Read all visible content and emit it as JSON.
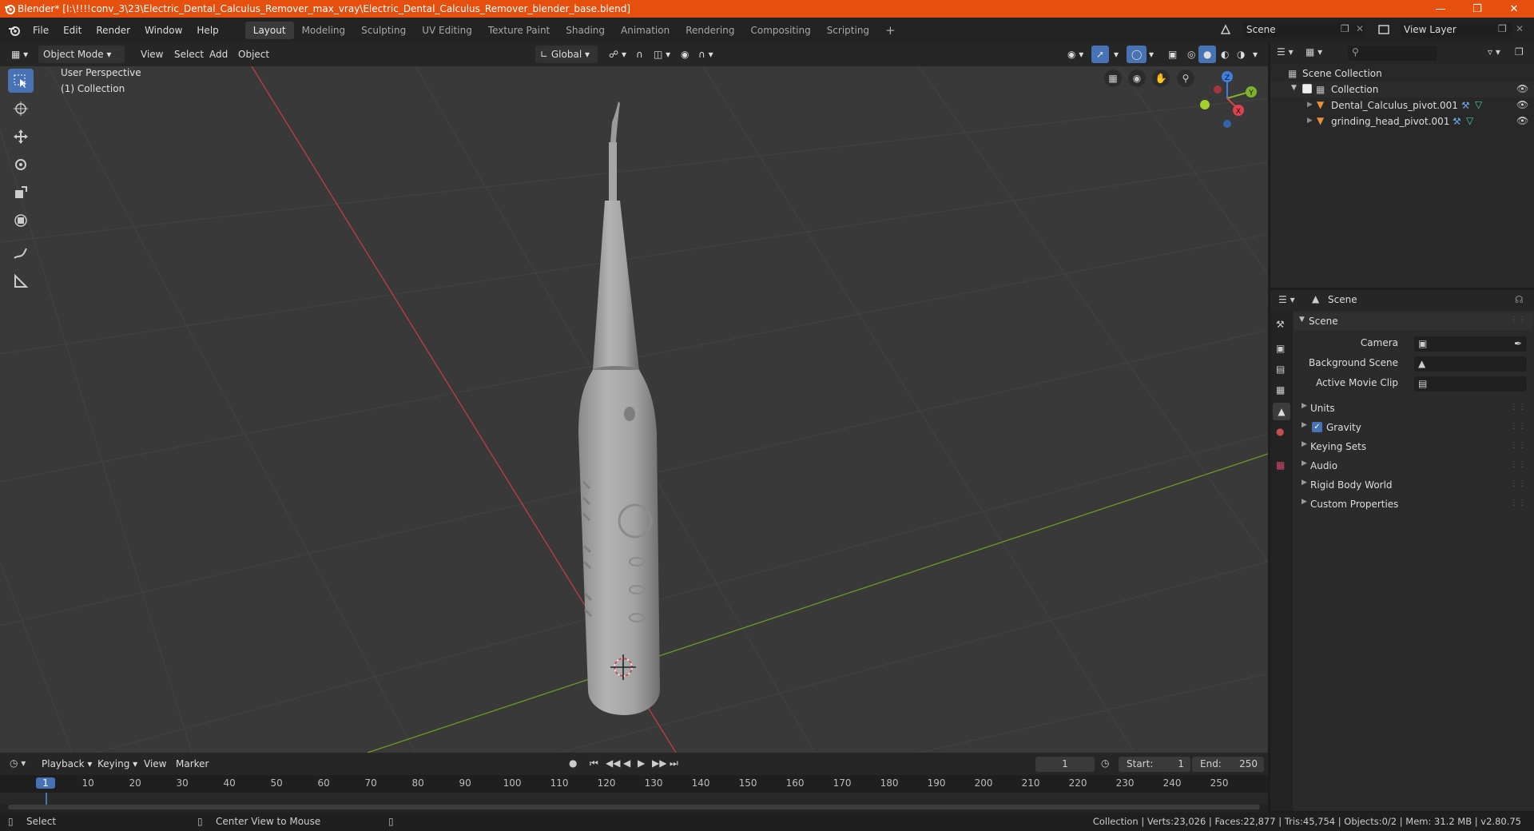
{
  "title": "Blender* [I:\\!!!!conv_3\\23\\Electric_Dental_Calculus_Remover_max_vray\\Electric_Dental_Calculus_Remover_blender_base.blend]",
  "menus": [
    "File",
    "Edit",
    "Render",
    "Window",
    "Help"
  ],
  "workspaces": [
    "Layout",
    "Modeling",
    "Sculpting",
    "UV Editing",
    "Texture Paint",
    "Shading",
    "Animation",
    "Rendering",
    "Compositing",
    "Scripting"
  ],
  "active_workspace": "Layout",
  "scene_name": "Scene",
  "view_layer": "View Layer",
  "viewport": {
    "mode": "Object Mode",
    "menus": [
      "View",
      "Select",
      "Add",
      "Object"
    ],
    "transform_orientation": "Global",
    "overlay_line1": "User Perspective",
    "overlay_line2": "(1) Collection",
    "gizmo": {
      "z": "Z",
      "y": "Y",
      "x": "X"
    }
  },
  "outliner": {
    "root": "Scene Collection",
    "collection": "Collection",
    "objects": [
      "Dental_Calculus_pivot.001",
      "grinding_head_pivot.001"
    ]
  },
  "properties": {
    "context": "Scene",
    "panel": "Scene",
    "fields": [
      {
        "label": "Camera"
      },
      {
        "label": "Background Scene"
      },
      {
        "label": "Active Movie Clip"
      }
    ],
    "sections": [
      "Units",
      "Gravity",
      "Keying Sets",
      "Audio",
      "Rigid Body World",
      "Custom Properties"
    ],
    "gravity_checked": true
  },
  "timeline": {
    "menus": [
      "Playback",
      "Keying",
      "View",
      "Marker"
    ],
    "current_frame": "1",
    "start_label": "Start:",
    "start": "1",
    "end_label": "End:",
    "end": "250",
    "ruler": [
      "1",
      "10",
      "20",
      "30",
      "40",
      "50",
      "60",
      "70",
      "80",
      "90",
      "100",
      "110",
      "120",
      "130",
      "140",
      "150",
      "160",
      "170",
      "180",
      "190",
      "200",
      "210",
      "220",
      "230",
      "240",
      "250"
    ]
  },
  "status": {
    "left1": "Select",
    "left2": "Center View to Mouse",
    "right": "Collection | Verts:23,026 | Faces:22,877 | Tris:45,754 | Objects:0/2 | Mem: 31.2 MB | v2.80.75"
  },
  "colors": {
    "accent": "#4772b3",
    "titlebar": "#e5500f",
    "x_axis": "#c23c4a",
    "y_axis": "#6c9a24"
  }
}
